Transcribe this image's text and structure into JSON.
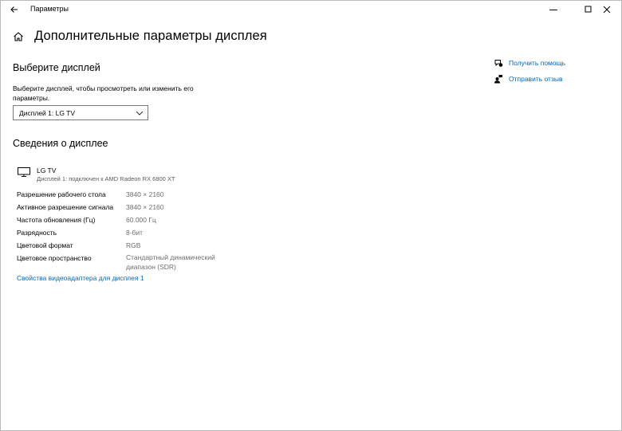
{
  "window": {
    "title": "Параметры"
  },
  "page": {
    "title": "Дополнительные параметры дисплея"
  },
  "choose_display": {
    "heading": "Выберите дисплей",
    "description": "Выберите дисплей, чтобы просмотреть или изменить его параметры.",
    "selected": "Дисплей 1: LG TV"
  },
  "display_info": {
    "heading": "Сведения о дисплее",
    "name": "LG TV",
    "subtitle": "Дисплей 1: подключен к AMD Radeon RX 6800 XT",
    "rows": [
      {
        "label": "Разрешение рабочего стола",
        "value": "3840 × 2160"
      },
      {
        "label": "Активное разрешение сигнала",
        "value": "3840 × 2160"
      },
      {
        "label": "Частота обновления (Гц)",
        "value": "60.000 Гц"
      },
      {
        "label": "Разрядность",
        "value": "8-бит"
      },
      {
        "label": "Цветовой формат",
        "value": "RGB"
      },
      {
        "label": "Цветовое пространство",
        "value": "Стандартный динамический диапазон (SDR)"
      }
    ],
    "adapter_link": "Свойства видеоадаптера для дисплея 1"
  },
  "side_links": {
    "help": "Получить помощь",
    "feedback": "Отправить отзыв"
  },
  "colors": {
    "accent": "#0067c0",
    "muted": "#6e6e6e"
  }
}
